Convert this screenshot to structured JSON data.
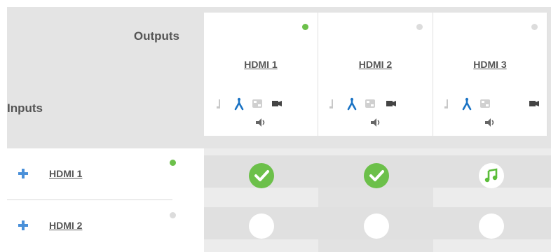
{
  "matrix": {
    "outputs_heading": "Outputs",
    "inputs_heading": "Inputs"
  },
  "outputs": [
    {
      "label": "HDMI 1",
      "status": "active"
    },
    {
      "label": "HDMI 2",
      "status": "inactive"
    },
    {
      "label": "HDMI 3",
      "status": "inactive"
    }
  ],
  "output_icons": [
    "audio-plug-icon",
    "routing-merge-icon",
    "pattern-grid-icon",
    "video-camera-icon",
    "speaker-volume-icon"
  ],
  "inputs": [
    {
      "label": "HDMI 1",
      "status": "active"
    },
    {
      "label": "HDMI 2",
      "status": "inactive"
    }
  ],
  "crosspoints": [
    [
      "video-audio",
      "video-audio",
      "audio-only"
    ],
    [
      "none",
      "none",
      "none"
    ]
  ],
  "colors": {
    "active": "#6cc04a",
    "inactive": "#dcdcdc",
    "accent_blue": "#1a73c4",
    "header_bg": "#e4e4e4",
    "grid_bg": "#ececec"
  }
}
